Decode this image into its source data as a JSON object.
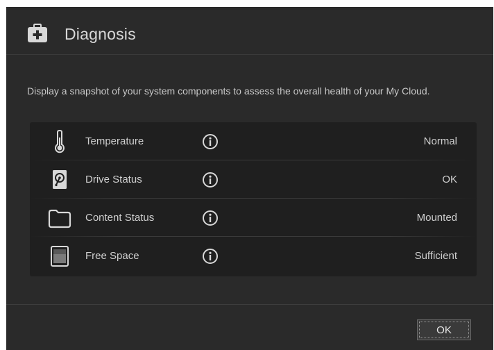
{
  "dialog": {
    "title": "Diagnosis",
    "description": "Display a snapshot of your system components to assess the overall health of your My Cloud.",
    "ok_label": "OK"
  },
  "rows": [
    {
      "icon": "thermometer-icon",
      "label": "Temperature",
      "value": "Normal"
    },
    {
      "icon": "hard-drive-icon",
      "label": "Drive Status",
      "value": "OK"
    },
    {
      "icon": "folder-icon",
      "label": "Content Status",
      "value": "Mounted"
    },
    {
      "icon": "storage-icon",
      "label": "Free Space",
      "value": "Sufficient"
    }
  ],
  "colors": {
    "dialog_bg": "#2a2a2a",
    "panel_bg": "#1f1f1f",
    "text": "#cfcfcf",
    "icon": "#d8d8d8"
  }
}
